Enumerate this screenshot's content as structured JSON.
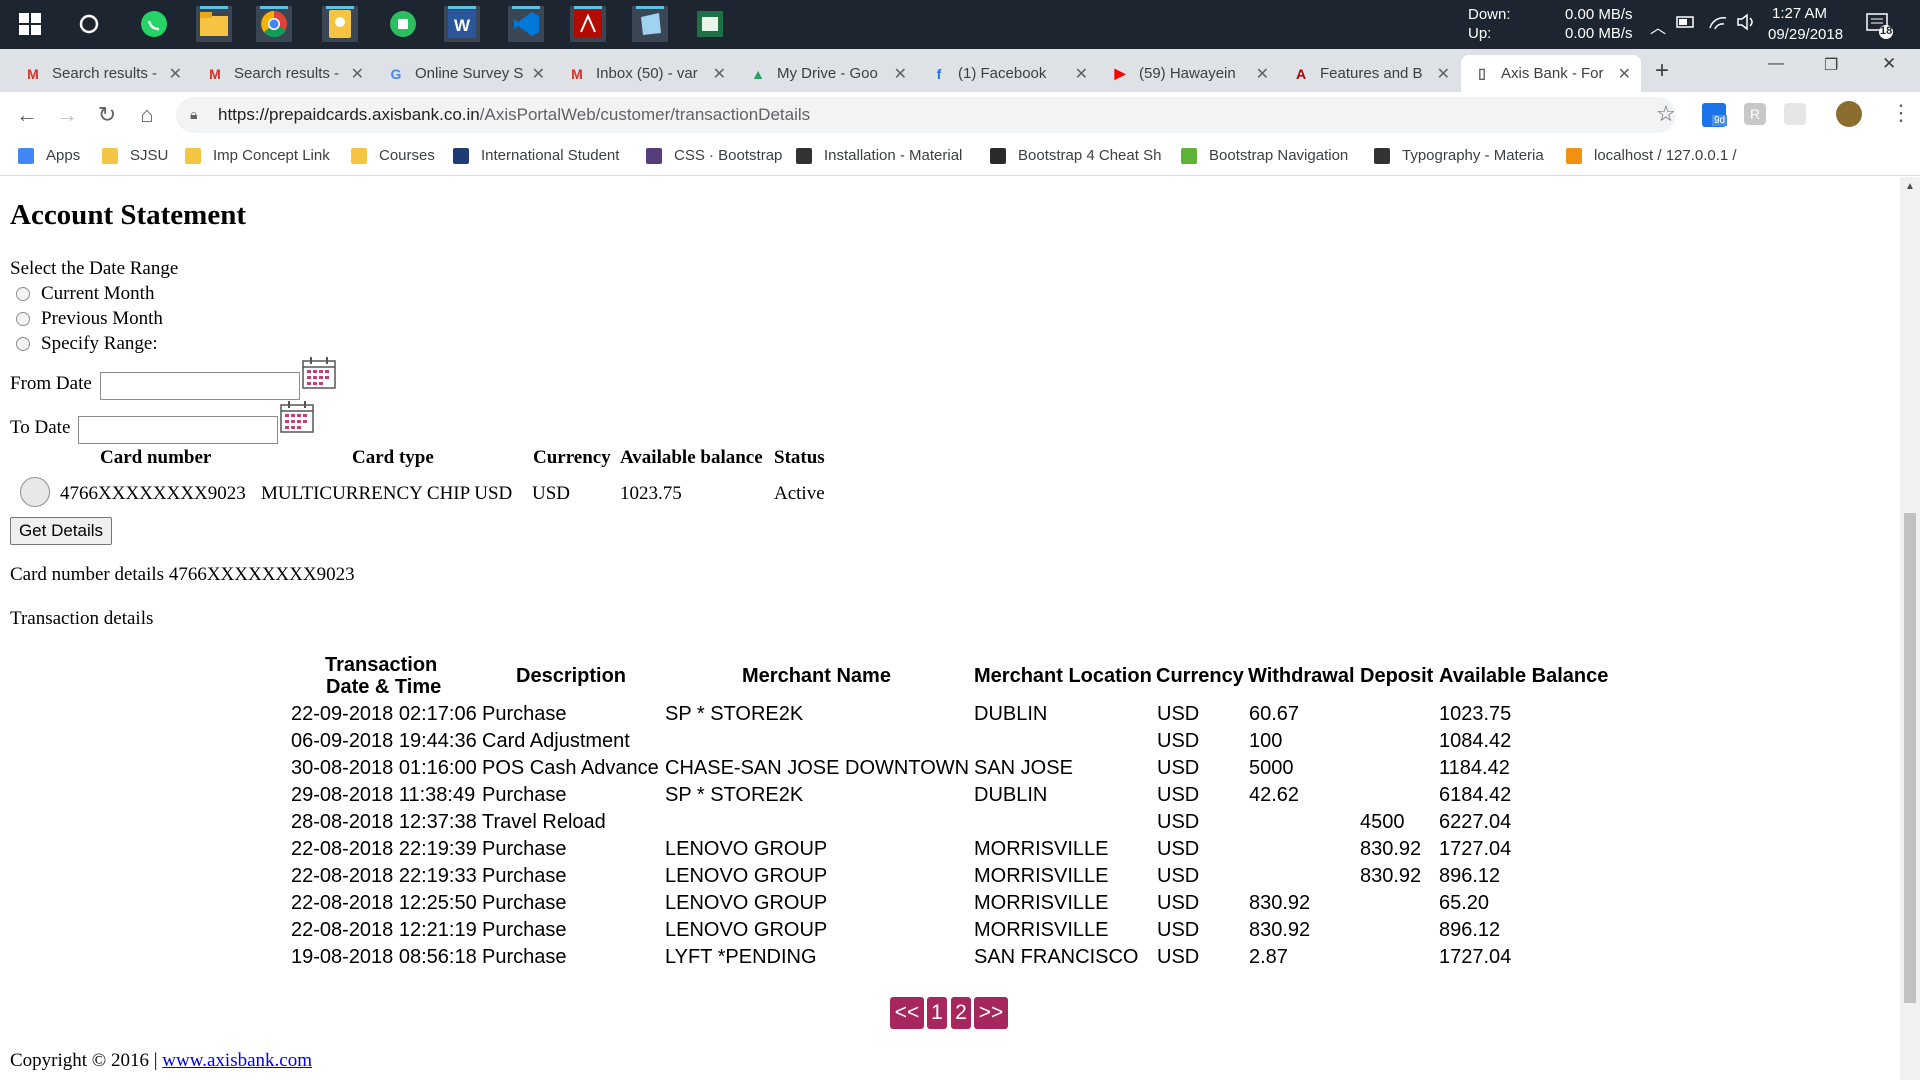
{
  "taskbar": {
    "network_down_label": "Down:",
    "network_up_label": "Up:",
    "network_down_value": "0.00 MB/s",
    "network_up_value": "0.00 MB/s",
    "time": "1:27 AM",
    "date": "09/29/2018",
    "notification_count": "18",
    "icons": [
      "windows-start-icon",
      "cortana-icon",
      "whatsapp-icon",
      "file-explorer-icon",
      "chrome-icon",
      "keep-icon",
      "evernote-icon",
      "word-icon",
      "vscode-icon",
      "acrobat-icon",
      "notes-icon",
      "sheets-icon"
    ]
  },
  "tabs": [
    {
      "title": "Search results -",
      "favicon": "M"
    },
    {
      "title": "Search results -",
      "favicon": "M"
    },
    {
      "title": "Online Survey S",
      "favicon": "G"
    },
    {
      "title": "Inbox (50) - var",
      "favicon": "M"
    },
    {
      "title": "My Drive - Goo",
      "favicon": "▲"
    },
    {
      "title": "(1) Facebook",
      "favicon": "f"
    },
    {
      "title": "(59) Hawayein",
      "favicon": "▶"
    },
    {
      "title": "Features and B",
      "favicon": "A"
    },
    {
      "title": "Axis Bank - For",
      "favicon": "▯"
    }
  ],
  "window_controls": {
    "minimize": "—",
    "restore": "❐",
    "close": "✕",
    "new_tab": "+"
  },
  "toolbar": {
    "url_host": "https://prepaidcards.axisbank.co.in",
    "url_path": "/AxisPortalWeb/customer/transactionDetails",
    "extension_badge": "9d"
  },
  "bookmarks": [
    {
      "label": "Apps",
      "color": "#4285f4"
    },
    {
      "label": "SJSU",
      "color": "#f4c542"
    },
    {
      "label": "Imp Concept Link",
      "color": "#f4c542"
    },
    {
      "label": "Courses",
      "color": "#f4c542"
    },
    {
      "label": "International Student",
      "color": "#1f3b73"
    },
    {
      "label": "CSS · Bootstrap",
      "color": "#563d7c"
    },
    {
      "label": "Installation - Material",
      "color": "#333333"
    },
    {
      "label": "Bootstrap 4 Cheat Sh",
      "color": "#2b2b2b"
    },
    {
      "label": "Bootstrap Navigation",
      "color": "#5fb336"
    },
    {
      "label": "Typography - Materia",
      "color": "#333333"
    },
    {
      "label": "localhost / 127.0.0.1 /",
      "color": "#f29111"
    }
  ],
  "page": {
    "title": "Account Statement",
    "date_range_label": "Select the Date Range",
    "radio_options": [
      "Current Month",
      "Previous Month",
      "Specify Range:"
    ],
    "from_date_label": "From Date",
    "to_date_label": "To Date",
    "from_date_value": "",
    "to_date_value": "",
    "card_table": {
      "headers": [
        "Card number",
        "Card type",
        "Currency",
        "Available balance",
        "Status"
      ],
      "row": {
        "card_number": "4766XXXXXXXX9023",
        "card_type": "MULTICURRENCY CHIP USD",
        "currency": "USD",
        "available_balance": "1023.75",
        "status": "Active"
      }
    },
    "get_details_button": "Get Details",
    "card_number_details_label": "Card number details 4766XXXXXXXX9023",
    "transaction_details_label": "Transaction details",
    "transactions": {
      "headers": {
        "datetime_line1": "Transaction",
        "datetime_line2": "Date & Time",
        "description": "Description",
        "merchant_name": "Merchant Name",
        "merchant_location": "Merchant Location",
        "currency": "Currency",
        "withdrawal": "Withdrawal",
        "deposit": "Deposit",
        "available_balance": "Available Balance"
      },
      "rows": [
        {
          "datetime": "22-09-2018 02:17:06",
          "description": "Purchase",
          "merchant_name": "SP * STORE2K",
          "merchant_location": "DUBLIN",
          "currency": "USD",
          "withdrawal": "60.67",
          "deposit": "",
          "balance": "1023.75"
        },
        {
          "datetime": "06-09-2018 19:44:36",
          "description": "Card Adjustment",
          "merchant_name": "",
          "merchant_location": "",
          "currency": "USD",
          "withdrawal": "100",
          "deposit": "",
          "balance": "1084.42"
        },
        {
          "datetime": "30-08-2018 01:16:00",
          "description": "POS Cash Advance",
          "merchant_name": "CHASE-SAN JOSE DOWNTOWN",
          "merchant_location": "SAN JOSE",
          "currency": "USD",
          "withdrawal": "5000",
          "deposit": "",
          "balance": "1184.42"
        },
        {
          "datetime": "29-08-2018 11:38:49",
          "description": "Purchase",
          "merchant_name": "SP * STORE2K",
          "merchant_location": "DUBLIN",
          "currency": "USD",
          "withdrawal": "42.62",
          "deposit": "",
          "balance": "6184.42"
        },
        {
          "datetime": "28-08-2018 12:37:38",
          "description": "Travel Reload",
          "merchant_name": "",
          "merchant_location": "",
          "currency": "USD",
          "withdrawal": "",
          "deposit": "4500",
          "balance": "6227.04"
        },
        {
          "datetime": "22-08-2018 22:19:39",
          "description": "Purchase",
          "merchant_name": "LENOVO GROUP",
          "merchant_location": "MORRISVILLE",
          "currency": "USD",
          "withdrawal": "",
          "deposit": "830.92",
          "balance": "1727.04"
        },
        {
          "datetime": "22-08-2018 22:19:33",
          "description": "Purchase",
          "merchant_name": "LENOVO GROUP",
          "merchant_location": "MORRISVILLE",
          "currency": "USD",
          "withdrawal": "",
          "deposit": "830.92",
          "balance": "896.12"
        },
        {
          "datetime": "22-08-2018 12:25:50",
          "description": "Purchase",
          "merchant_name": "LENOVO GROUP",
          "merchant_location": "MORRISVILLE",
          "currency": "USD",
          "withdrawal": "830.92",
          "deposit": "",
          "balance": "65.20"
        },
        {
          "datetime": "22-08-2018 12:21:19",
          "description": "Purchase",
          "merchant_name": "LENOVO GROUP",
          "merchant_location": "MORRISVILLE",
          "currency": "USD",
          "withdrawal": "830.92",
          "deposit": "",
          "balance": "896.12"
        },
        {
          "datetime": "19-08-2018 08:56:18",
          "description": "Purchase",
          "merchant_name": "LYFT *PENDING",
          "merchant_location": "SAN FRANCISCO",
          "currency": "USD",
          "withdrawal": "2.87",
          "deposit": "",
          "balance": "1727.04"
        }
      ]
    },
    "pagination": {
      "prev": "<<",
      "pages": [
        "1",
        "2"
      ],
      "next": ">>",
      "color": "#a8265e"
    },
    "footer": {
      "copyright": "Copyright © 2016 |",
      "link": "www.axisbank.com"
    }
  }
}
